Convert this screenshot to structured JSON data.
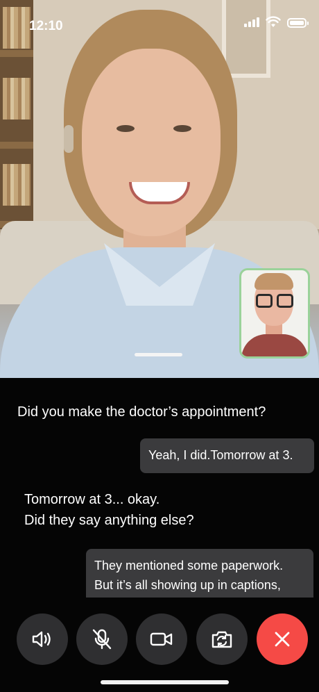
{
  "status_bar": {
    "time": "12:10",
    "signal_icon": "cellular-signal-icon",
    "wifi_icon": "wifi-icon",
    "battery_icon": "battery-full-icon"
  },
  "captions": [
    {
      "speaker": "remote",
      "lines": [
        "Did you make the doctor’s appointment?"
      ]
    },
    {
      "speaker": "self",
      "lines": [
        "Yeah, I did.Tomorrow at 3."
      ]
    },
    {
      "speaker": "remote",
      "lines": [
        "Tomorrow at 3... okay.",
        "Did they say anything else?"
      ]
    },
    {
      "speaker": "self",
      "lines": [
        "They mentioned some paperwork.",
        "But  it’s all showing up in captions,"
      ]
    }
  ],
  "controls": [
    {
      "name": "speaker-button",
      "icon": "speaker-icon"
    },
    {
      "name": "mute-button",
      "icon": "microphone-off-icon"
    },
    {
      "name": "video-button",
      "icon": "video-camera-icon"
    },
    {
      "name": "switch-camera-button",
      "icon": "switch-camera-icon"
    },
    {
      "name": "end-call-button",
      "icon": "close-icon"
    }
  ],
  "colors": {
    "background": "#050505",
    "caption_bubble": "#3b3b3d",
    "control_button": "#2f2f31",
    "end_call": "#f54a46",
    "selfview_border": "#9ad29a"
  }
}
